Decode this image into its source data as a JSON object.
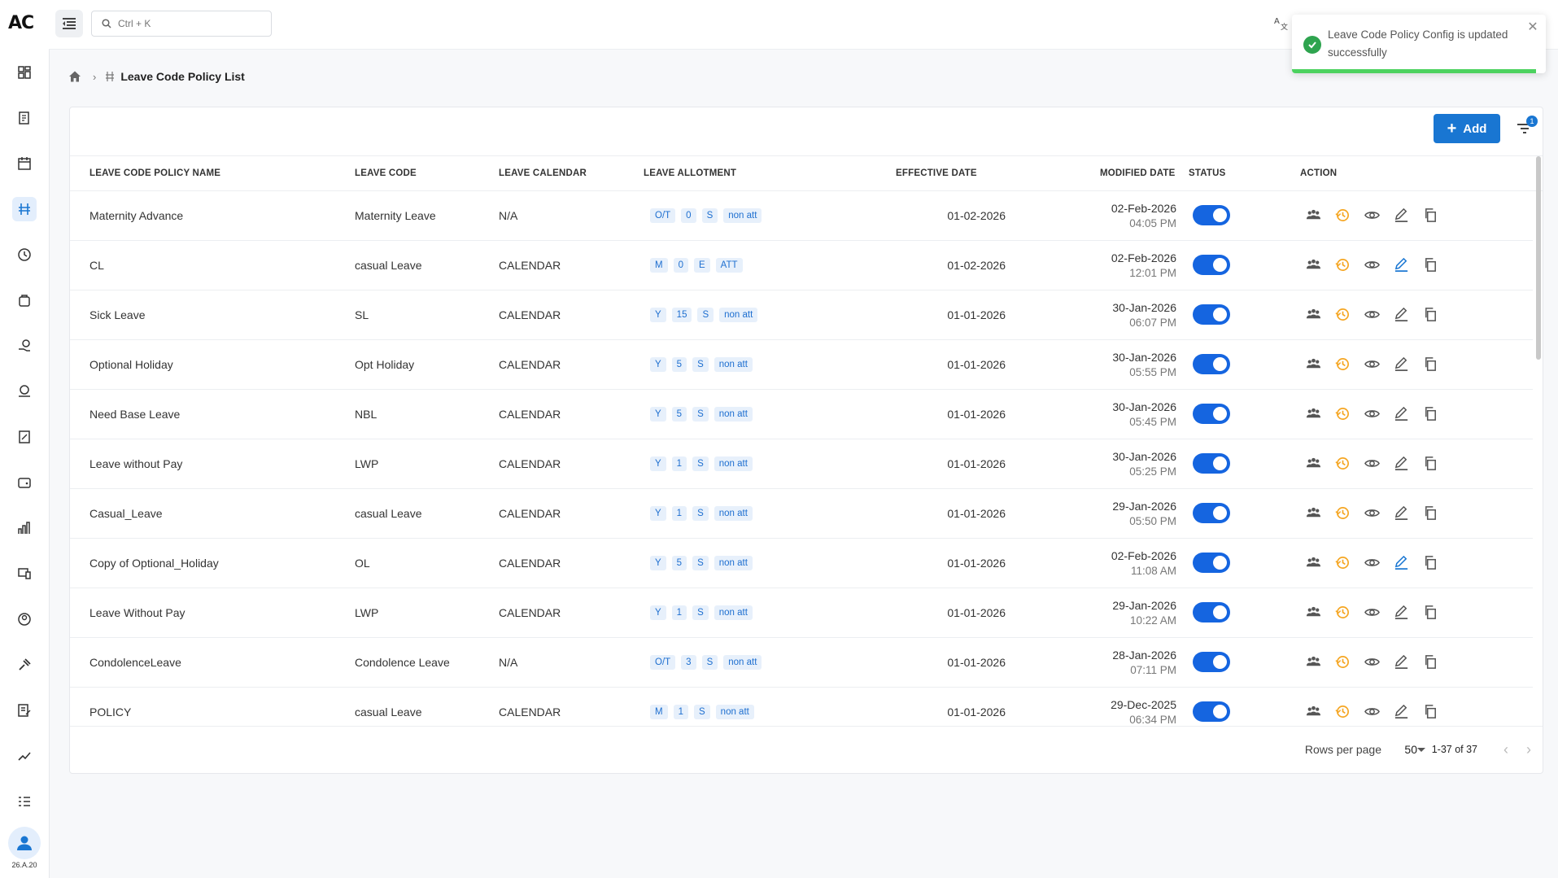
{
  "app": {
    "logo": "AC",
    "version": "26.A.20"
  },
  "sidebar": {
    "items": [
      {
        "icon": "dashboard-icon"
      },
      {
        "icon": "clipboard-edit-icon"
      },
      {
        "icon": "calendar-icon"
      },
      {
        "icon": "leave-code-icon",
        "active": true
      },
      {
        "icon": "clock-history-icon"
      },
      {
        "icon": "briefcase-icon"
      },
      {
        "icon": "hand-coin-icon"
      },
      {
        "icon": "money-icon"
      },
      {
        "icon": "percent-doc-icon"
      },
      {
        "icon": "wallet-icon"
      },
      {
        "icon": "analytics-icon"
      },
      {
        "icon": "devices-icon"
      },
      {
        "icon": "user-circle-icon"
      },
      {
        "icon": "gavel-icon"
      },
      {
        "icon": "notes-edit-icon"
      },
      {
        "icon": "trend-icon"
      },
      {
        "icon": "checklist-icon"
      }
    ]
  },
  "search": {
    "placeholder": "Ctrl + K"
  },
  "toast": {
    "message": "Leave Code Policy Config is updated successfully",
    "type": "success"
  },
  "breadcrumb": {
    "title": "Leave Code Policy List"
  },
  "toolbar": {
    "add_label": "Add",
    "filter_count": "1"
  },
  "table": {
    "columns": {
      "name": "LEAVE CODE POLICY NAME",
      "code": "LEAVE CODE",
      "calendar": "LEAVE CALENDAR",
      "allotment": "LEAVE ALLOTMENT",
      "effective": "EFFECTIVE DATE",
      "modified": "MODIFIED DATE",
      "status": "STATUS",
      "action": "ACTION"
    },
    "rows": [
      {
        "name": "Maternity Advance",
        "code": "Maternity Leave",
        "calendar": "N/A",
        "allotment": [
          "O/T",
          "0",
          "S",
          "non att"
        ],
        "effective": "01-02-2026",
        "modified_date": "02-Feb-2026",
        "modified_time": "04:05 PM",
        "status": true,
        "edit_highlight": false
      },
      {
        "name": "CL",
        "code": "casual Leave",
        "calendar": "CALENDAR",
        "allotment": [
          "M",
          "0",
          "E",
          "ATT"
        ],
        "effective": "01-02-2026",
        "modified_date": "02-Feb-2026",
        "modified_time": "12:01 PM",
        "status": true,
        "edit_highlight": true
      },
      {
        "name": "Sick Leave",
        "code": "SL",
        "calendar": "CALENDAR",
        "allotment": [
          "Y",
          "15",
          "S",
          "non att"
        ],
        "effective": "01-01-2026",
        "modified_date": "30-Jan-2026",
        "modified_time": "06:07 PM",
        "status": true,
        "edit_highlight": false
      },
      {
        "name": "Optional Holiday",
        "code": "Opt Holiday",
        "calendar": "CALENDAR",
        "allotment": [
          "Y",
          "5",
          "S",
          "non att"
        ],
        "effective": "01-01-2026",
        "modified_date": "30-Jan-2026",
        "modified_time": "05:55 PM",
        "status": true,
        "edit_highlight": false
      },
      {
        "name": "Need Base Leave",
        "code": "NBL",
        "calendar": "CALENDAR",
        "allotment": [
          "Y",
          "5",
          "S",
          "non att"
        ],
        "effective": "01-01-2026",
        "modified_date": "30-Jan-2026",
        "modified_time": "05:45 PM",
        "status": true,
        "edit_highlight": false
      },
      {
        "name": "Leave without Pay",
        "code": "LWP",
        "calendar": "CALENDAR",
        "allotment": [
          "Y",
          "1",
          "S",
          "non att"
        ],
        "effective": "01-01-2026",
        "modified_date": "30-Jan-2026",
        "modified_time": "05:25 PM",
        "status": true,
        "edit_highlight": false
      },
      {
        "name": "Casual_Leave",
        "code": "casual Leave",
        "calendar": "CALENDAR",
        "allotment": [
          "Y",
          "1",
          "S",
          "non att"
        ],
        "effective": "01-01-2026",
        "modified_date": "29-Jan-2026",
        "modified_time": "05:50 PM",
        "status": true,
        "edit_highlight": false
      },
      {
        "name": "Copy of Optional_Holiday",
        "code": "OL",
        "calendar": "CALENDAR",
        "allotment": [
          "Y",
          "5",
          "S",
          "non att"
        ],
        "effective": "01-01-2026",
        "modified_date": "02-Feb-2026",
        "modified_time": "11:08 AM",
        "status": true,
        "edit_highlight": true
      },
      {
        "name": "Leave Without Pay",
        "code": "LWP",
        "calendar": "CALENDAR",
        "allotment": [
          "Y",
          "1",
          "S",
          "non att"
        ],
        "effective": "01-01-2026",
        "modified_date": "29-Jan-2026",
        "modified_time": "10:22 AM",
        "status": true,
        "edit_highlight": false
      },
      {
        "name": "CondolenceLeave",
        "code": "Condolence Leave",
        "calendar": "N/A",
        "allotment": [
          "O/T",
          "3",
          "S",
          "non att"
        ],
        "effective": "01-01-2026",
        "modified_date": "28-Jan-2026",
        "modified_time": "07:11 PM",
        "status": true,
        "edit_highlight": false
      },
      {
        "name": "POLICY",
        "code": "casual Leave",
        "calendar": "CALENDAR",
        "allotment": [
          "M",
          "1",
          "S",
          "non att"
        ],
        "effective": "01-01-2026",
        "modified_date": "29-Dec-2025",
        "modified_time": "06:34 PM",
        "status": true,
        "edit_highlight": false
      }
    ]
  },
  "pagination": {
    "rows_per_page_label": "Rows per page",
    "rows_per_page": "50",
    "range": "1-37 of 37"
  },
  "colors": {
    "primary": "#1976d2",
    "toggle": "#1565e0",
    "history": "#f5a623",
    "success": "#2ea44f",
    "chip_bg": "#e7f0fb"
  }
}
